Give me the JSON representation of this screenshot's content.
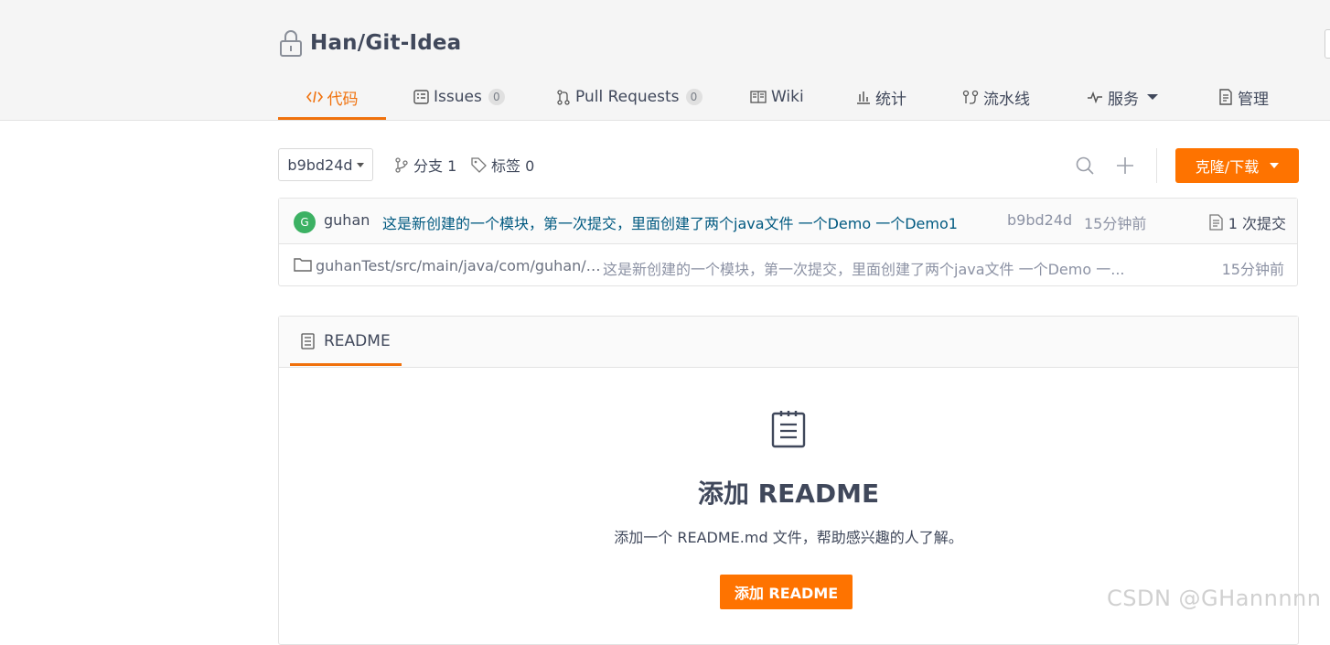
{
  "repo": {
    "title": "Han/Git-Idea"
  },
  "tabs": [
    {
      "label": "代码",
      "icon": "code-icon"
    },
    {
      "label": "Issues",
      "count": "0",
      "icon": "issues-icon"
    },
    {
      "label": "Pull Requests",
      "count": "0",
      "icon": "pull-request-icon"
    },
    {
      "label": "Wiki",
      "icon": "wiki-icon"
    },
    {
      "label": "统计",
      "icon": "chart-icon"
    },
    {
      "label": "流水线",
      "icon": "pipeline-icon"
    },
    {
      "label": "服务",
      "icon": "service-icon"
    },
    {
      "label": "管理",
      "icon": "manage-icon"
    }
  ],
  "toolbar": {
    "branch": "b9bd24d",
    "branches_label": "分支 1",
    "tags_label": "标签 0",
    "clone_label": "克隆/下载"
  },
  "commit": {
    "avatar_letter": "G",
    "author": "guhan",
    "message": "这是新创建的一个模块，第一次提交，里面创建了两个java文件 一个Demo 一个Demo1",
    "sha": "b9bd24d",
    "time": "15分钟前",
    "count_label": "1 次提交"
  },
  "files": [
    {
      "path": "guhanTest/src/main/java/com/guhan/t...",
      "message": "这是新创建的一个模块，第一次提交，里面创建了两个java文件 一个Demo 一...",
      "time": "15分钟前"
    }
  ],
  "readme": {
    "tab_label": "README",
    "empty_title": "添加 README",
    "empty_desc": "添加一个 README.md 文件，帮助感兴趣的人了解。",
    "button_label": "添加 README"
  },
  "watermark": "CSDN @GHannnnn",
  "colors": {
    "accent": "#fe7300",
    "link": "#005980",
    "text": "#40485b"
  }
}
